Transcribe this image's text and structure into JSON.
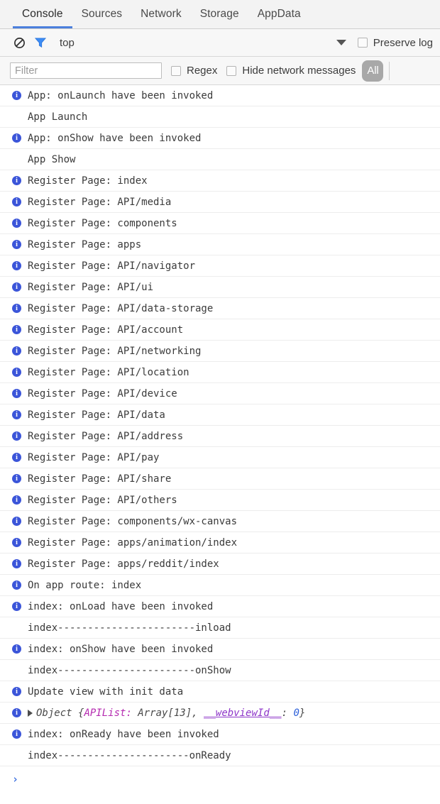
{
  "tabs": [
    {
      "label": "Console",
      "active": true
    },
    {
      "label": "Sources",
      "active": false
    },
    {
      "label": "Network",
      "active": false
    },
    {
      "label": "Storage",
      "active": false
    },
    {
      "label": "AppData",
      "active": false
    }
  ],
  "toolbar": {
    "clear_icon": "no-entry-clear-icon",
    "filter_icon": "funnel-filter-icon",
    "context_label": "top",
    "dropdown_icon": "chevron-down-icon",
    "preserve_log_label": "Preserve log",
    "preserve_log_checked": false
  },
  "filterbar": {
    "filter_placeholder": "Filter",
    "filter_value": "",
    "regex_label": "Regex",
    "regex_checked": false,
    "hide_network_label": "Hide network messages",
    "hide_network_checked": false,
    "level_badge": "All"
  },
  "console": {
    "rows": [
      {
        "icon": true,
        "text": "App: onLaunch have been invoked"
      },
      {
        "icon": false,
        "text": "App Launch"
      },
      {
        "icon": true,
        "text": "App: onShow have been invoked"
      },
      {
        "icon": false,
        "text": "App Show"
      },
      {
        "icon": true,
        "text": "Register Page: index"
      },
      {
        "icon": true,
        "text": "Register Page: API/media"
      },
      {
        "icon": true,
        "text": "Register Page: components"
      },
      {
        "icon": true,
        "text": "Register Page: apps"
      },
      {
        "icon": true,
        "text": "Register Page: API/navigator"
      },
      {
        "icon": true,
        "text": "Register Page: API/ui"
      },
      {
        "icon": true,
        "text": "Register Page: API/data-storage"
      },
      {
        "icon": true,
        "text": "Register Page: API/account"
      },
      {
        "icon": true,
        "text": "Register Page: API/networking"
      },
      {
        "icon": true,
        "text": "Register Page: API/location"
      },
      {
        "icon": true,
        "text": "Register Page: API/device"
      },
      {
        "icon": true,
        "text": "Register Page: API/data"
      },
      {
        "icon": true,
        "text": "Register Page: API/address"
      },
      {
        "icon": true,
        "text": "Register Page: API/pay"
      },
      {
        "icon": true,
        "text": "Register Page: API/share"
      },
      {
        "icon": true,
        "text": "Register Page: API/others"
      },
      {
        "icon": true,
        "text": "Register Page: components/wx-canvas"
      },
      {
        "icon": true,
        "text": "Register Page: apps/animation/index"
      },
      {
        "icon": true,
        "text": "Register Page: apps/reddit/index"
      },
      {
        "icon": true,
        "text": "On app route: index"
      },
      {
        "icon": true,
        "text": "index: onLoad have been invoked"
      },
      {
        "icon": false,
        "text": "index-----------------------inload"
      },
      {
        "icon": true,
        "text": "index: onShow have been invoked"
      },
      {
        "icon": false,
        "text": "index-----------------------onShow"
      },
      {
        "icon": true,
        "text": "Update view with init data"
      }
    ],
    "object_row": {
      "disclosure_icon": "triangle-right-icon",
      "type_label": "Object",
      "brace_open": " {",
      "key1": "APIList:",
      "value1": " Array[13],",
      "key2": "__webviewId__",
      "colon": ":",
      "value2": " 0",
      "brace_close": "}"
    },
    "rows_after": [
      {
        "icon": true,
        "text": "index: onReady have been invoked"
      },
      {
        "icon": false,
        "text": "index----------------------onReady"
      }
    ],
    "prompt_symbol": "›"
  }
}
